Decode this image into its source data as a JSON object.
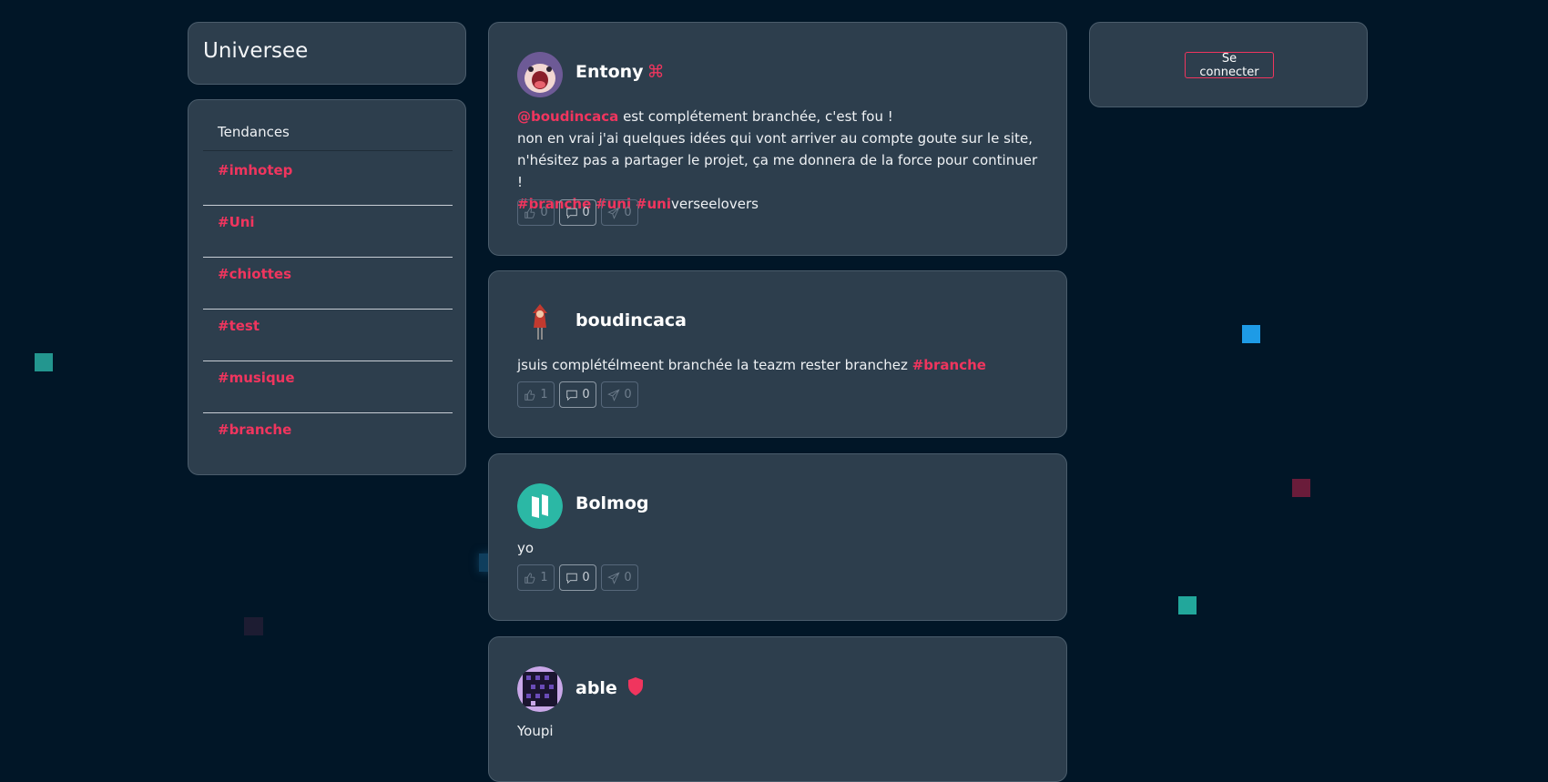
{
  "app": {
    "title": "Universee"
  },
  "trends": {
    "heading": "Tendances",
    "items": [
      {
        "label": "#imhotep"
      },
      {
        "label": "#Uni"
      },
      {
        "label": "#chiottes"
      },
      {
        "label": "#test"
      },
      {
        "label": "#musique"
      },
      {
        "label": "#branche"
      }
    ]
  },
  "auth": {
    "login_label": "Se connecter"
  },
  "posts": [
    {
      "author": "Entony",
      "badge": "⌘",
      "avatar_icon": "screaming-character-avatar",
      "text": {
        "mention": "@boudincaca",
        "line1_rest": " est complétement branchée, c'est fou !",
        "line2": "non en vrai j'ai quelques idées qui vont arriver au compte goute sur le site,",
        "line3": "n'hésitez pas a partager le projet, ça me donnera de la force pour continuer !",
        "tag1": "#branche",
        "tag2": "#uni",
        "tag3": "#uni",
        "tail": "verseelovers"
      },
      "likes": "0",
      "comments": "0",
      "shares": "0"
    },
    {
      "author": "boudincaca",
      "avatar_icon": "red-hooded-character-avatar",
      "text": {
        "body": "jsuis complétélmeent branchée la teazm rester branchez ",
        "tag": "#branche"
      },
      "likes": "1",
      "comments": "0",
      "shares": "0"
    },
    {
      "author": "Bolmog",
      "avatar_icon": "teal-logo-avatar",
      "text": {
        "body": "yo"
      },
      "likes": "1",
      "comments": "0",
      "shares": "0"
    },
    {
      "author": "able",
      "avatar_icon": "pixel-pattern-avatar",
      "badge_icon": "shield-icon",
      "text": {
        "body": "Youpi"
      }
    }
  ],
  "colors": {
    "background": "#011627",
    "panel": "#2d3e4d",
    "accent": "#f0355e"
  }
}
